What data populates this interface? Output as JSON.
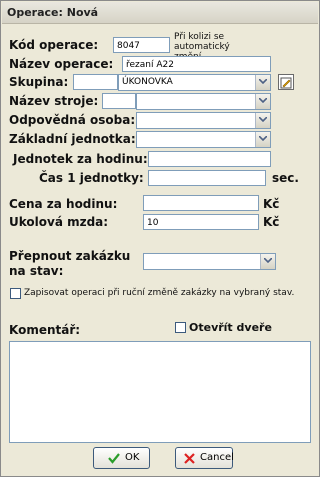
{
  "window": {
    "title": "Operace: Nová"
  },
  "form": {
    "kod_label": "Kód operace:",
    "kod_value": "8047",
    "kod_note": "Při kolizi se automatický změní",
    "nazev_label": "Název operace:",
    "nazev_value": "řezaní A22",
    "skupina_label": "Skupina:",
    "skupina_value": "ÚKONOVKA",
    "stroj_label": "Název stroje:",
    "osoba_label": "Odpovědná osoba:",
    "jednotka_label": "Základní jednotka:",
    "jzh_label": "Jednotek za hodinu:",
    "cas_label": "Čas 1 jednotky:",
    "cas_unit": "sec.",
    "cena_label": "Cena za hodinu:",
    "cena_unit": "Kč",
    "mzda_label": "Ukolová mzda:",
    "mzda_value": "10",
    "mzda_unit": "Kč",
    "prepnout_label_1": "Přepnout zakázku",
    "prepnout_label_2": "na stav:",
    "zapis_label": "Zapisovat operaci při ruční změně zakázky na vybraný stav.",
    "komentar_label": "Komentář:",
    "otevrit_label": "Otevřít dveře"
  },
  "buttons": {
    "ok": "OK",
    "cancel": "Cancel"
  }
}
